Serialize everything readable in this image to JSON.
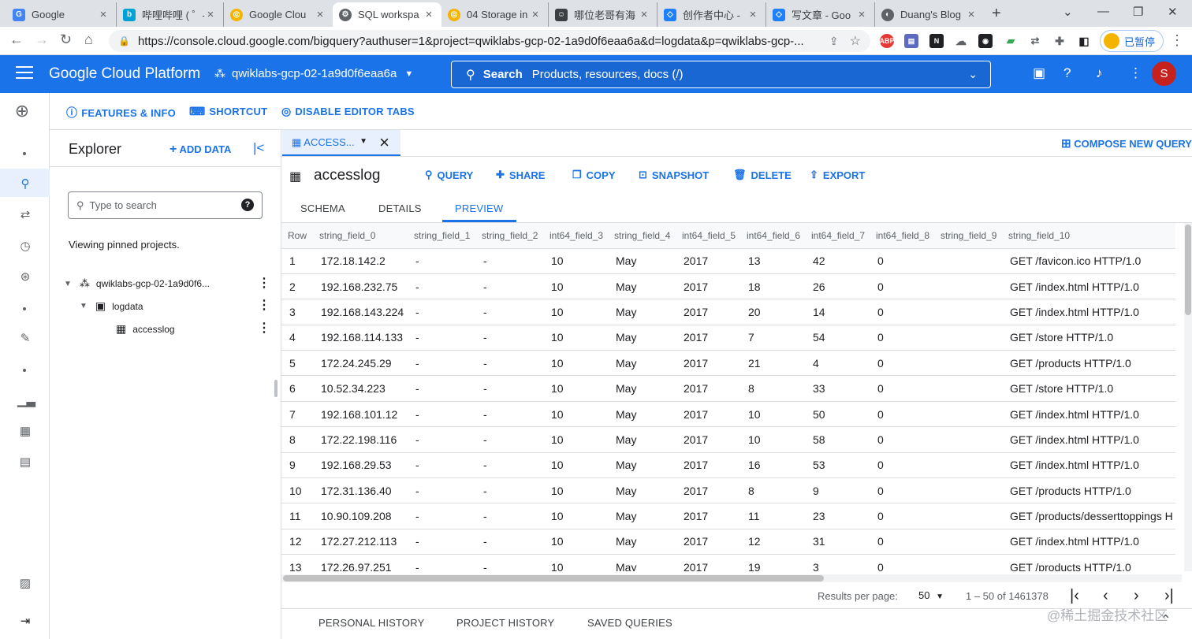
{
  "browser": {
    "tabs": [
      {
        "title": "Google",
        "icon": "google-g-icon",
        "color": "#4285f4"
      },
      {
        "title": "哔哩哔哩 ( ゜- ",
        "icon": "bilibili-icon",
        "color": "#00a1d6"
      },
      {
        "title": "Google Clou",
        "icon": "qwiklabs-icon",
        "color": "#f4b400"
      },
      {
        "title": "SQL workspa",
        "icon": "gcp-gear-icon",
        "color": "#5f6368"
      },
      {
        "title": "04 Storage in",
        "icon": "qwiklabs-icon",
        "color": "#f4b400"
      },
      {
        "title": "哪位老哥有海",
        "icon": "avatar-icon",
        "color": "#3c4043"
      },
      {
        "title": "创作者中心 - ",
        "icon": "juejin-icon",
        "color": "#1e80ff"
      },
      {
        "title": "写文章 - Goo",
        "icon": "juejin-icon",
        "color": "#1e80ff"
      },
      {
        "title": "Duang's Blog",
        "icon": "blog-icon",
        "color": "#5f6368"
      }
    ],
    "url": "https://console.cloud.google.com/bigquery?authuser=1&project=qwiklabs-gcp-02-1a9d0f6eaa6a&d=logdata&p=qwiklabs-gcp-...",
    "paused_label": "已暂停"
  },
  "header": {
    "brand": "Google Cloud Platform",
    "project": "qwiklabs-gcp-02-1a9d0f6eaa6a",
    "search_label": "Search",
    "search_placeholder": "Products, resources, docs (/)",
    "avatar_initial": "S",
    "primary_color": "#1a73e8"
  },
  "toolbar": {
    "features": "FEATURES & INFO",
    "shortcut": "SHORTCUT",
    "disable_tabs": "DISABLE EDITOR TABS"
  },
  "explorer": {
    "title": "Explorer",
    "add_data": "ADD DATA",
    "search_placeholder": "Type to search",
    "viewing": "Viewing pinned projects.",
    "project": "qwiklabs-gcp-02-1a9d0f6...",
    "dataset": "logdata",
    "table": "accesslog"
  },
  "editor": {
    "tab_label": "ACCESS...",
    "compose": "COMPOSE NEW QUERY",
    "table_name": "accesslog",
    "actions": {
      "query": "QUERY",
      "share": "SHARE",
      "copy": "COPY",
      "snapshot": "SNAPSHOT",
      "delete": "DELETE",
      "export": "EXPORT"
    },
    "subtabs": {
      "schema": "SCHEMA",
      "details": "DETAILS",
      "preview": "PREVIEW"
    }
  },
  "grid": {
    "columns": [
      "Row",
      "string_field_0",
      "string_field_1",
      "string_field_2",
      "int64_field_3",
      "string_field_4",
      "int64_field_5",
      "int64_field_6",
      "int64_field_7",
      "int64_field_8",
      "string_field_9",
      "string_field_10"
    ],
    "rows": [
      [
        "1",
        "172.18.142.2",
        "-",
        "-",
        "10",
        "May",
        "2017",
        "13",
        "42",
        "0",
        "",
        "GET /favicon.ico HTTP/1.0"
      ],
      [
        "2",
        "192.168.232.75",
        "-",
        "-",
        "10",
        "May",
        "2017",
        "18",
        "26",
        "0",
        "",
        "GET /index.html HTTP/1.0"
      ],
      [
        "3",
        "192.168.143.224",
        "-",
        "-",
        "10",
        "May",
        "2017",
        "20",
        "14",
        "0",
        "",
        "GET /index.html HTTP/1.0"
      ],
      [
        "4",
        "192.168.114.133",
        "-",
        "-",
        "10",
        "May",
        "2017",
        "7",
        "54",
        "0",
        "",
        "GET /store HTTP/1.0"
      ],
      [
        "5",
        "172.24.245.29",
        "-",
        "-",
        "10",
        "May",
        "2017",
        "21",
        "4",
        "0",
        "",
        "GET /products HTTP/1.0"
      ],
      [
        "6",
        "10.52.34.223",
        "-",
        "-",
        "10",
        "May",
        "2017",
        "8",
        "33",
        "0",
        "",
        "GET /store HTTP/1.0"
      ],
      [
        "7",
        "192.168.101.12",
        "-",
        "-",
        "10",
        "May",
        "2017",
        "10",
        "50",
        "0",
        "",
        "GET /index.html HTTP/1.0"
      ],
      [
        "8",
        "172.22.198.116",
        "-",
        "-",
        "10",
        "May",
        "2017",
        "10",
        "58",
        "0",
        "",
        "GET /index.html HTTP/1.0"
      ],
      [
        "9",
        "192.168.29.53",
        "-",
        "-",
        "10",
        "May",
        "2017",
        "16",
        "53",
        "0",
        "",
        "GET /index.html HTTP/1.0"
      ],
      [
        "10",
        "172.31.136.40",
        "-",
        "-",
        "10",
        "May",
        "2017",
        "8",
        "9",
        "0",
        "",
        "GET /products HTTP/1.0"
      ],
      [
        "11",
        "10.90.109.208",
        "-",
        "-",
        "10",
        "May",
        "2017",
        "11",
        "23",
        "0",
        "",
        "GET /products/desserttoppings H"
      ],
      [
        "12",
        "172.27.212.113",
        "-",
        "-",
        "10",
        "May",
        "2017",
        "12",
        "31",
        "0",
        "",
        "GET /index.html HTTP/1.0"
      ],
      [
        "13",
        "172.26.97.251",
        "-",
        "-",
        "10",
        "May",
        "2017",
        "19",
        "3",
        "0",
        "",
        "GET /products HTTP/1.0"
      ]
    ]
  },
  "pager": {
    "label": "Results per page:",
    "per_page": "50",
    "range": "1 – 50 of 1461378"
  },
  "history": {
    "personal": "PERSONAL HISTORY",
    "project": "PROJECT HISTORY",
    "saved": "SAVED QUERIES"
  },
  "watermark": "@稀土掘金技术社区"
}
